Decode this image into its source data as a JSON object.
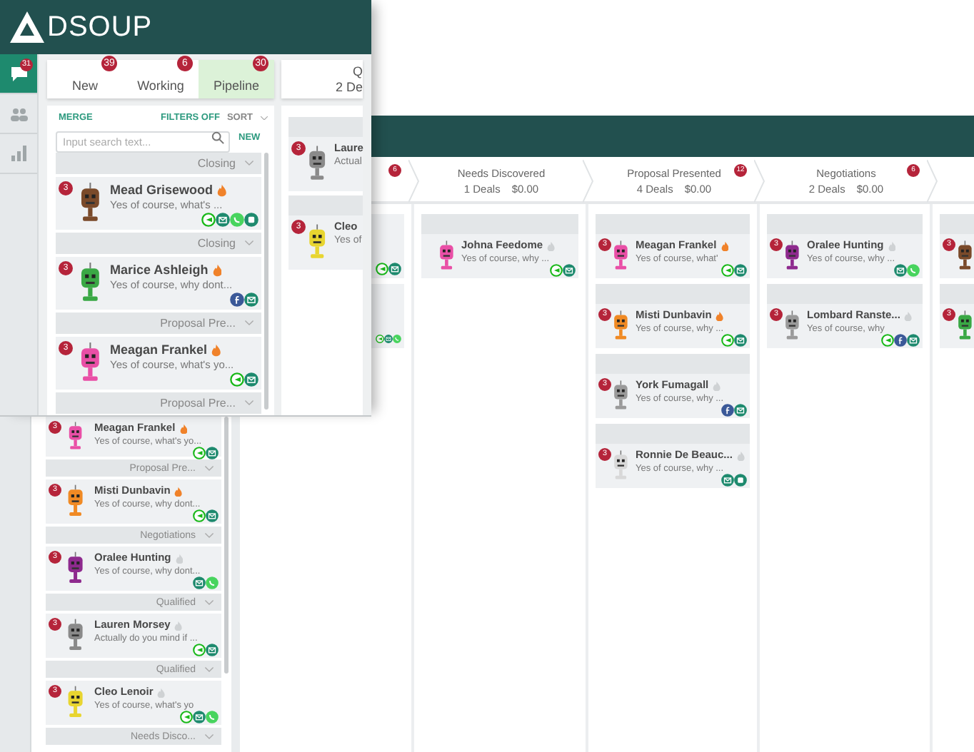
{
  "front": {
    "logo": "DSOUP",
    "nav": [
      {
        "kind": "chat",
        "selected": true,
        "badge": "31"
      },
      {
        "kind": "people",
        "selected": false
      },
      {
        "kind": "chart",
        "selected": false
      }
    ],
    "tabs": [
      {
        "label": "New",
        "count": "39",
        "selected": false
      },
      {
        "label": "Working",
        "count": "6",
        "selected": false
      },
      {
        "label": "Pipeline",
        "count": "30",
        "selected": true
      }
    ],
    "stage_peek": {
      "title": "Q",
      "subtitle": "2 De"
    },
    "toolbar": {
      "merge": "MERGE",
      "filters": "FILTERS OFF",
      "sort": "SORT"
    },
    "search": {
      "placeholder": "Input search text..."
    },
    "new_button": "NEW",
    "conversations": [
      {
        "stage": "Closing",
        "badge": "3",
        "name": "Mead Grisewood",
        "hot": true,
        "message": "Yes of course, what's ...",
        "color": "#7a4a2a",
        "channels": [
          {
            "kind": "line"
          },
          {
            "kind": "mail"
          },
          {
            "kind": "whatsapp"
          },
          {
            "kind": "chat"
          }
        ]
      },
      {
        "stage": "Closing",
        "badge": "3",
        "name": "Marice Ashleigh",
        "hot": true,
        "message": "Yes of course, why dont...",
        "color": "#3aa845",
        "channels": [
          {
            "kind": "facebook"
          },
          {
            "kind": "mail"
          }
        ]
      },
      {
        "stage": "Proposal Pre...",
        "badge": "3",
        "name": "Meagan Frankel",
        "hot": true,
        "message": "Yes of course, what's yo...",
        "color": "#e94fa6",
        "channels": [
          {
            "kind": "line"
          },
          {
            "kind": "mail"
          }
        ]
      },
      {
        "stage": "Proposal Pre..."
      }
    ],
    "peek_cards": [
      {
        "badge": "3",
        "name": "Laure",
        "message": "Actual",
        "color": "#8a8a8a"
      },
      {
        "badge": "3",
        "name": "Cleo",
        "message": "Yes of",
        "color": "#e8d530"
      }
    ]
  },
  "back": {
    "conversations": [
      {
        "badge": "3",
        "name": "Meagan Frankel",
        "hot": true,
        "message": "Yes of course, what's yo...",
        "color": "#e94fa6",
        "channels": [
          {
            "kind": "line"
          },
          {
            "kind": "mail"
          }
        ]
      },
      {
        "stage": "Proposal Pre...",
        "badge": "3",
        "name": "Misti Dunbavin",
        "hot": true,
        "message": "Yes of course, why dont...",
        "color": "#f08a24",
        "channels": [
          {
            "kind": "line"
          },
          {
            "kind": "mail"
          }
        ]
      },
      {
        "stage": "Negotiations",
        "badge": "3",
        "name": "Oralee Hunting",
        "hot": false,
        "message": "Yes of course, why dont...",
        "color": "#8e2a8e",
        "channels": [
          {
            "kind": "mail"
          },
          {
            "kind": "whatsapp"
          }
        ]
      },
      {
        "stage": "Qualified",
        "badge": "3",
        "name": "Lauren Morsey",
        "hot": false,
        "message": "Actually do you mind if ...",
        "color": "#8a8a8a",
        "channels": [
          {
            "kind": "line"
          },
          {
            "kind": "mail"
          }
        ]
      },
      {
        "stage": "Qualified",
        "badge": "3",
        "name": "Cleo Lenoir",
        "hot": false,
        "message": "Yes of course, what's yo",
        "color": "#e8d530",
        "channels": [
          {
            "kind": "line"
          },
          {
            "kind": "mail"
          },
          {
            "kind": "whatsapp"
          }
        ]
      },
      {
        "stage": "Needs Disco..."
      }
    ],
    "stages": [
      {
        "badge": "6"
      },
      {
        "title": "Needs Discovered",
        "deals": "1 Deals",
        "amount": "$0.00"
      },
      {
        "title": "Proposal Presented",
        "deals": "4 Deals",
        "amount": "$0.00",
        "badge": "12"
      },
      {
        "title": "Negotiations",
        "deals": "2 Deals",
        "amount": "$0.00",
        "badge": "6"
      }
    ],
    "columns": [
      {
        "cards": [
          {
            "channels": [
              {
                "kind": "line"
              },
              {
                "kind": "mail"
              }
            ]
          },
          {
            "channels": [
              {
                "kind": "line"
              },
              {
                "kind": "mail"
              },
              {
                "kind": "whatsapp"
              }
            ]
          }
        ]
      },
      {
        "cards": [
          {
            "name": "Johna Feedome",
            "hot": false,
            "message": "Yes of course, why ...",
            "color": "#e94fa6",
            "channels": [
              {
                "kind": "line"
              },
              {
                "kind": "mail"
              }
            ]
          }
        ]
      },
      {
        "cards": [
          {
            "badge": "3",
            "name": "Meagan Frankel",
            "hot": true,
            "message": "Yes of course, what'",
            "color": "#e94fa6",
            "channels": [
              {
                "kind": "line"
              },
              {
                "kind": "mail"
              }
            ]
          },
          {
            "badge": "3",
            "name": "Misti Dunbavin",
            "hot": true,
            "message": "Yes of course, why ...",
            "color": "#f08a24",
            "channels": [
              {
                "kind": "line"
              },
              {
                "kind": "mail"
              }
            ]
          },
          {
            "badge": "3",
            "name": "York Fumagall",
            "hot": false,
            "message": "Yes of course, why ...",
            "color": "#9a9a9a",
            "channels": [
              {
                "kind": "facebook"
              },
              {
                "kind": "mail"
              }
            ]
          },
          {
            "badge": "3",
            "name": "Ronnie De Beauc...",
            "hot": false,
            "message": "Yes of course, why ...",
            "color": "#d8d8d8",
            "channels": [
              {
                "kind": "mail"
              },
              {
                "kind": "chat"
              }
            ]
          }
        ]
      },
      {
        "cards": [
          {
            "badge": "3",
            "name": "Oralee Hunting",
            "hot": false,
            "message": "Yes of course, why ...",
            "color": "#8e2a8e",
            "channels": [
              {
                "kind": "mail"
              },
              {
                "kind": "whatsapp"
              }
            ]
          },
          {
            "badge": "3",
            "name": "Lombard Ranste...",
            "hot": false,
            "message": "Yes of course, why",
            "color": "#9a9a9a",
            "channels": [
              {
                "kind": "line"
              },
              {
                "kind": "facebook"
              },
              {
                "kind": "mail"
              }
            ]
          }
        ]
      },
      {
        "cards": [
          {
            "badge": "3",
            "color": "#7a4a2a"
          },
          {
            "badge": "3",
            "color": "#3aa845"
          }
        ]
      }
    ]
  }
}
